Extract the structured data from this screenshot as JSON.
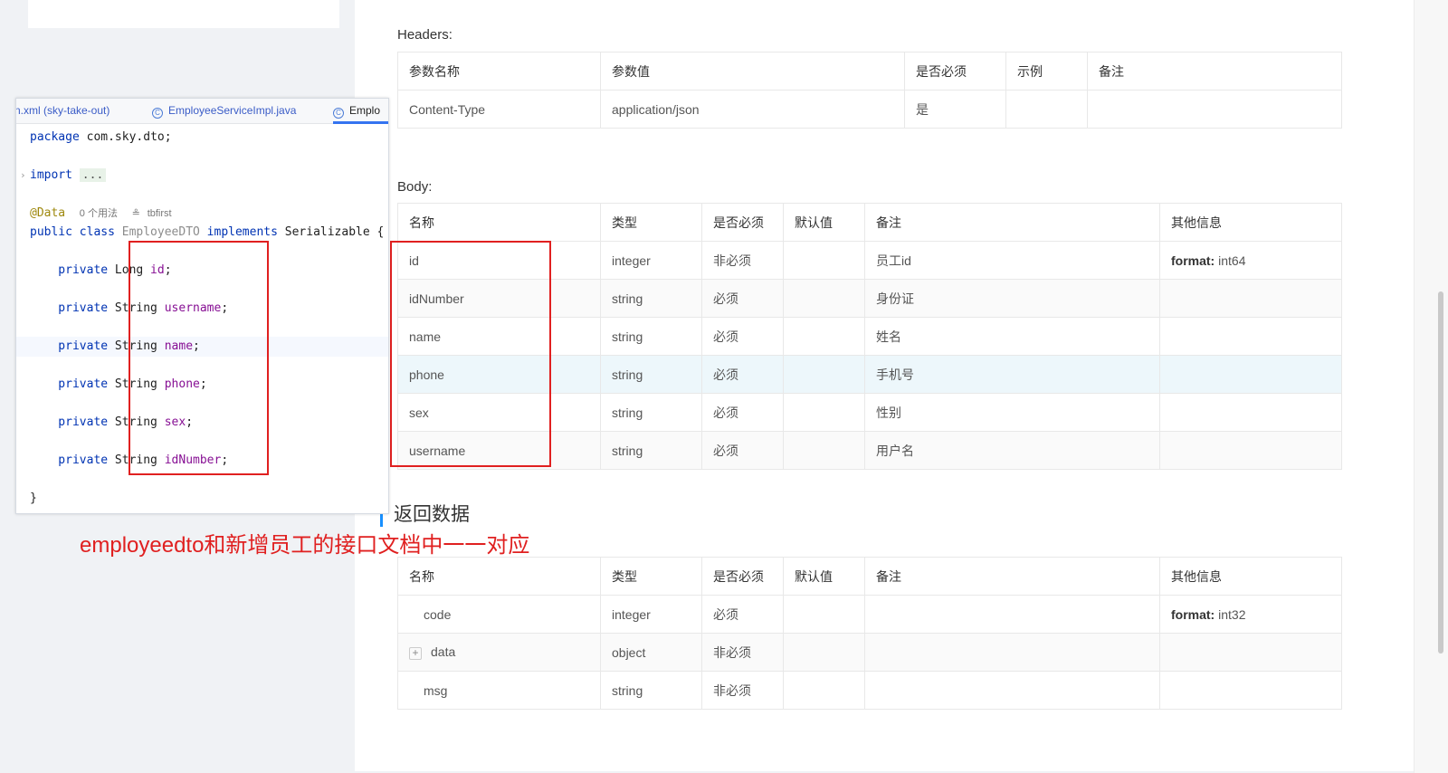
{
  "ide": {
    "tabs": [
      {
        "label": "n.xml (sky-take-out)",
        "icon": ""
      },
      {
        "label": "EmployeeServiceImpl.java",
        "icon": "class-icon"
      },
      {
        "label": "Emplo",
        "icon": "class-icon"
      }
    ],
    "code": {
      "package_kw": "package",
      "package_name": " com.sky.dto;",
      "import_kw": "import",
      "import_fold": "...",
      "annotation": "@Data",
      "usage_hint": "0 个用法",
      "author": "tbfirst",
      "class_decl_1": "public class",
      "class_name": " EmployeeDTO",
      "class_decl_2": " implements",
      "class_decl_3": " Serializable {",
      "fields": [
        {
          "kw": "    private",
          "type": " Long",
          "name": " id",
          "end": ";"
        },
        {
          "kw": "    private",
          "type": " String",
          "name": " username",
          "end": ";"
        },
        {
          "kw": "    private",
          "type": " String",
          "name": " name",
          "end": ";"
        },
        {
          "kw": "    private",
          "type": " String",
          "name": " phone",
          "end": ";"
        },
        {
          "kw": "    private",
          "type": " String",
          "name": " sex",
          "end": ";"
        },
        {
          "kw": "    private",
          "type": " String",
          "name": " idNumber",
          "end": ";"
        }
      ],
      "close_brace": "}"
    }
  },
  "caption": "employeedto和新增员工的接口文档中一一对应",
  "headers": {
    "title": "Headers:",
    "columns": [
      "参数名称",
      "参数值",
      "是否必须",
      "示例",
      "备注"
    ],
    "rows": [
      [
        "Content-Type",
        "application/json",
        "是",
        "",
        ""
      ]
    ]
  },
  "body": {
    "title": "Body:",
    "columns": [
      "名称",
      "类型",
      "是否必须",
      "默认值",
      "备注",
      "其他信息"
    ],
    "rows": [
      {
        "name": "id",
        "type": "integer",
        "required": "非必须",
        "default": "",
        "note": "员工id",
        "extra_key": "format:",
        "extra_val": " int64"
      },
      {
        "name": "idNumber",
        "type": "string",
        "required": "必须",
        "default": "",
        "note": "身份证",
        "extra_key": "",
        "extra_val": ""
      },
      {
        "name": "name",
        "type": "string",
        "required": "必须",
        "default": "",
        "note": "姓名",
        "extra_key": "",
        "extra_val": ""
      },
      {
        "name": "phone",
        "type": "string",
        "required": "必须",
        "default": "",
        "note": "手机号",
        "extra_key": "",
        "extra_val": ""
      },
      {
        "name": "sex",
        "type": "string",
        "required": "必须",
        "default": "",
        "note": "性别",
        "extra_key": "",
        "extra_val": ""
      },
      {
        "name": "username",
        "type": "string",
        "required": "必须",
        "default": "",
        "note": "用户名",
        "extra_key": "",
        "extra_val": ""
      }
    ]
  },
  "response": {
    "title": "返回数据",
    "columns": [
      "名称",
      "类型",
      "是否必须",
      "默认值",
      "备注",
      "其他信息"
    ],
    "rows": [
      {
        "name": "code",
        "type": "integer",
        "required": "必须",
        "default": "",
        "note": "",
        "extra_key": "format:",
        "extra_val": " int32",
        "expandable": false
      },
      {
        "name": "data",
        "type": "object",
        "required": "非必须",
        "default": "",
        "note": "",
        "extra_key": "",
        "extra_val": "",
        "expandable": true,
        "expand_symbol": "+"
      },
      {
        "name": "msg",
        "type": "string",
        "required": "非必须",
        "default": "",
        "note": "",
        "extra_key": "",
        "extra_val": "",
        "expandable": false
      }
    ]
  },
  "colors": {
    "accent": "#1890ff",
    "highlight_red": "#e02020"
  }
}
